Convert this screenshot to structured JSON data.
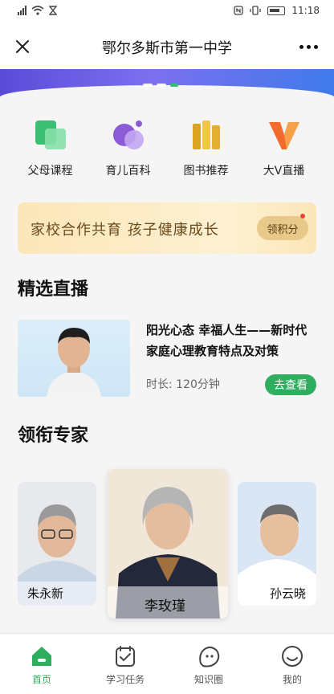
{
  "statusbar": {
    "time": "11:18"
  },
  "header": {
    "title": "鄂尔多斯市第一中学"
  },
  "quick_links": [
    {
      "label": "父母课程",
      "icon": "parent-course-icon"
    },
    {
      "label": "育儿百科",
      "icon": "parenting-encyclopedia-icon"
    },
    {
      "label": "图书推荐",
      "icon": "book-recommend-icon"
    },
    {
      "label": "大V直播",
      "icon": "big-v-live-icon"
    }
  ],
  "promo": {
    "text": "家校合作共育  孩子健康成长",
    "button": "领积分"
  },
  "live_section": {
    "title": "精选直播",
    "card": {
      "title": "阳光心态 幸福人生——新时代家庭心理教育特点及对策",
      "duration": "时长: 120分钟",
      "button": "去查看"
    }
  },
  "experts_section": {
    "title": "领衔专家",
    "experts": [
      "朱永新",
      "李玫瑾",
      "孙云晓"
    ]
  },
  "tabbar": {
    "items": [
      {
        "label": "首页",
        "icon": "home-icon",
        "active": true
      },
      {
        "label": "学习任务",
        "icon": "task-icon",
        "active": false
      },
      {
        "label": "知识圈",
        "icon": "knowledge-icon",
        "active": false
      },
      {
        "label": "我的",
        "icon": "profile-icon",
        "active": false
      }
    ]
  },
  "colors": {
    "accent": "#2fae5f",
    "banner_start": "#5a4cd8",
    "banner_end": "#3f7bea",
    "promo_bg": "#fbe6b8"
  }
}
